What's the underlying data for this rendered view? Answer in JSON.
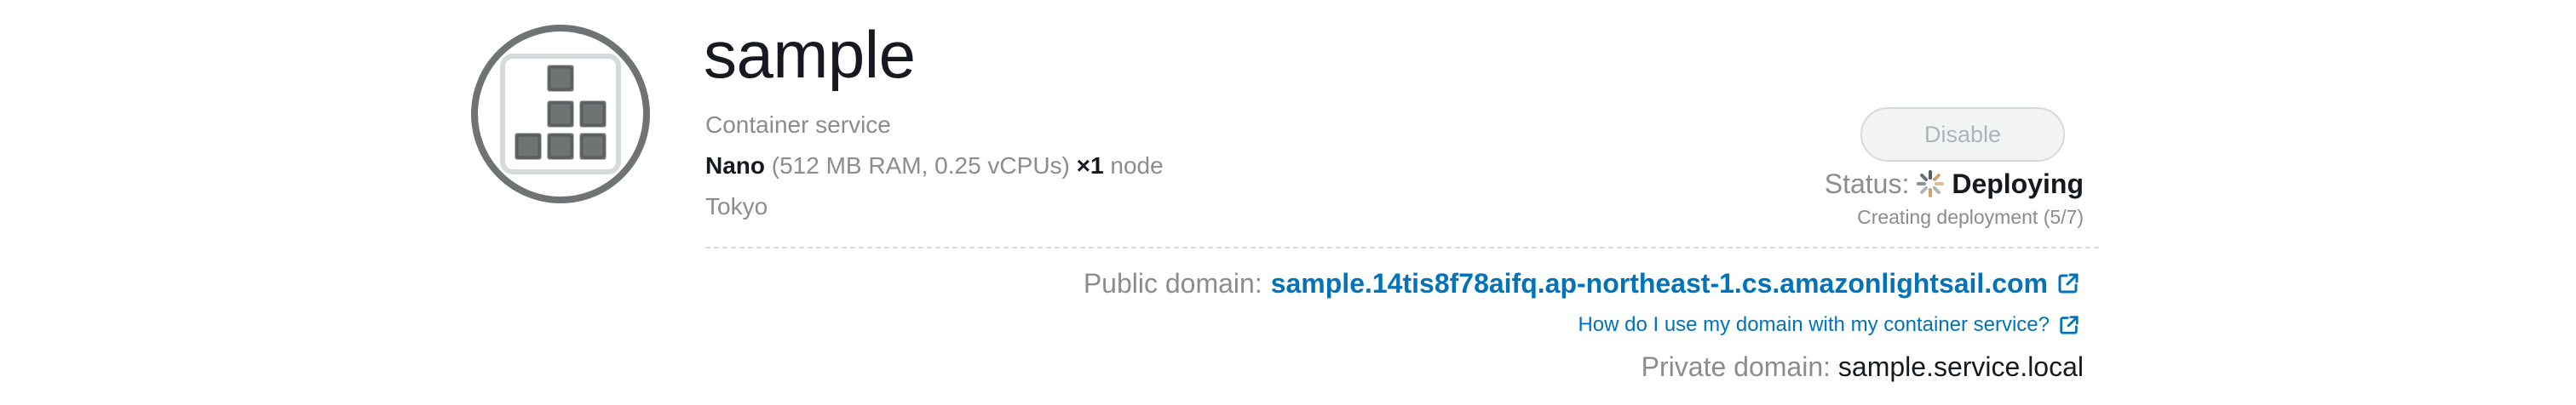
{
  "service": {
    "name": "sample",
    "type": "Container service",
    "power_name": "Nano",
    "power_specs": "(512 MB RAM, 0.25 vCPUs)",
    "scale": "×1",
    "scale_unit": "node",
    "region": "Tokyo",
    "icon": "container-service-icon"
  },
  "actions": {
    "disable_label": "Disable"
  },
  "status": {
    "label": "Status:",
    "value": "Deploying",
    "detail": "Creating deployment (5/7)",
    "icon": "spinner-icon"
  },
  "domains": {
    "public_label": "Public domain:",
    "public_value": "sample.14tis8f78aifq.ap-northeast-1.cs.amazonlightsail.com",
    "help_link": "How do I use my domain with my container service?",
    "private_label": "Private domain:",
    "private_value": "sample.service.local"
  },
  "colors": {
    "link": "#0073bb",
    "text": "#16191f",
    "muted": "#8c8c8c",
    "icon_grey": "#6f7373"
  }
}
